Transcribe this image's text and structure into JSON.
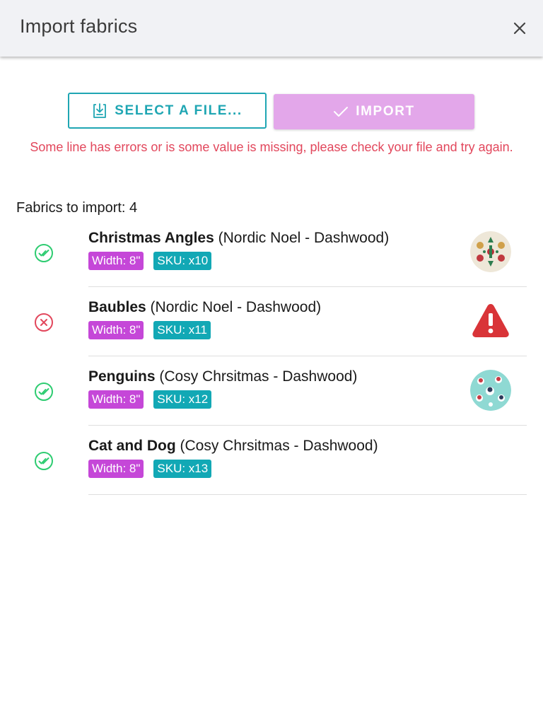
{
  "dialog": {
    "title": "Import fabrics",
    "close_icon": "close-icon"
  },
  "actions": {
    "select_file_label": "SELECT A FILE...",
    "select_file_icon": "file-download-icon",
    "import_label": "IMPORT",
    "import_icon": "check-icon"
  },
  "error_message": "Some line has errors or is some value is missing, please check your file and try again.",
  "summary": {
    "label": "Fabrics to import: 4"
  },
  "fabrics": [
    {
      "name": "Christmas Angles",
      "collection": " (Nordic Noel - Dashwood)",
      "width": "Width: 8\"",
      "sku": "SKU: x10",
      "status": "ok",
      "status_icon": "double-check-icon",
      "thumbnail": "nordic-pattern-thumbnail"
    },
    {
      "name": "Baubles",
      "collection": " (Nordic Noel - Dashwood)",
      "width": "Width: 8\"",
      "sku": "SKU: x11",
      "status": "error",
      "status_icon": "error-circle-icon",
      "thumbnail": "warning-triangle-icon"
    },
    {
      "name": "Penguins",
      "collection": " (Cosy Chrsitmas - Dashwood)",
      "width": "Width: 8\"",
      "sku": "SKU: x12",
      "status": "ok",
      "status_icon": "double-check-icon",
      "thumbnail": "penguin-pattern-thumbnail"
    },
    {
      "name": "Cat and Dog",
      "collection": " (Cosy Chrsitmas - Dashwood)",
      "width": "Width: 8\"",
      "sku": "SKU: x13",
      "status": "ok",
      "status_icon": "double-check-icon",
      "thumbnail": ""
    }
  ],
  "colors": {
    "accent_teal": "#1fa6b3",
    "import_disabled": "#e3a7ea",
    "error": "#e2475c",
    "success": "#2ecc71",
    "tag_width": "#c547d8",
    "tag_sku": "#12a8b5",
    "warning": "#d93438"
  }
}
